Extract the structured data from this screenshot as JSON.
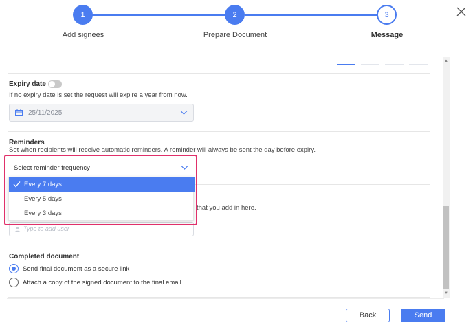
{
  "stepper": {
    "steps": [
      {
        "number": "1",
        "label": "Add signees"
      },
      {
        "number": "2",
        "label": "Prepare Document"
      },
      {
        "number": "3",
        "label": "Message"
      }
    ]
  },
  "expiry": {
    "title": "Expiry date",
    "toggle_on": false,
    "helper": "If no expiry date is set the request will expire a year from now.",
    "date_value": "25/11/2025"
  },
  "reminders": {
    "title": "Reminders",
    "helper": "Set when recipients will receive automatic reminders. A reminder will always be sent the day before expiry.",
    "select_placeholder": "Select reminder frequency",
    "options": [
      "Every 7 days",
      "Every 5 days",
      "Every 3 days"
    ],
    "selected_index": 0
  },
  "cc": {
    "partial_helper": "that you add in here.",
    "input_placeholder": "Type to add user"
  },
  "completed": {
    "title": "Completed document",
    "options": [
      "Send final document as a secure link",
      "Attach a copy of the signed document to the final email."
    ],
    "selected_index": 0
  },
  "footer": {
    "back_label": "Back",
    "send_label": "Send"
  },
  "colors": {
    "accent": "#4a7cf0",
    "highlight": "#e0306a"
  }
}
